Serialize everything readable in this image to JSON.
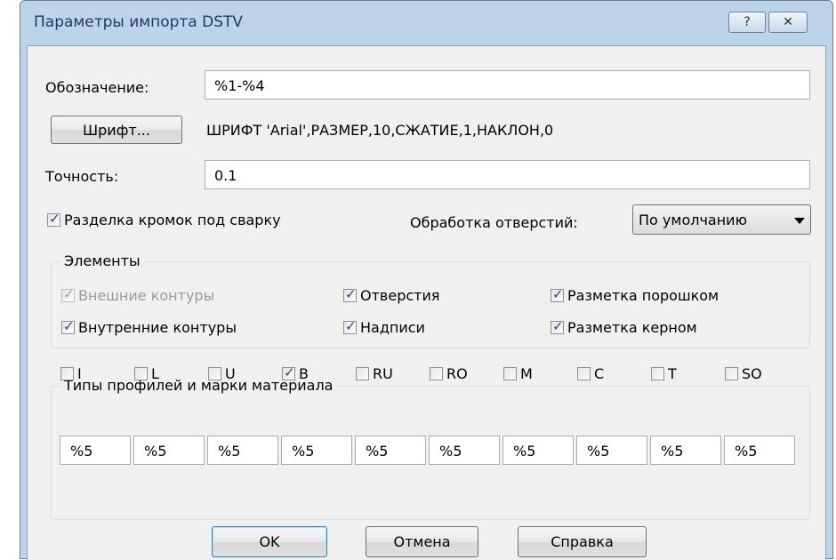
{
  "window": {
    "title": "Параметры импорта DSTV",
    "help_glyph": "?",
    "close_glyph": "✕"
  },
  "designation": {
    "label": "Обозначение:",
    "value": "%1-%4"
  },
  "font": {
    "button_label": "Шрифт...",
    "info": "ШРИФТ 'Arial',РАЗМЕР,10,СЖАТИЕ,1,НАКЛОН,0"
  },
  "precision": {
    "label": "Точность:",
    "value": "0.1"
  },
  "weld_prep": {
    "label": "Разделка кромок под сварку",
    "checked": true
  },
  "holes_processing": {
    "label": "Обработка отверстий:",
    "selected": "По умолчанию"
  },
  "elements": {
    "title": "Элементы",
    "outer_contours": {
      "label": "Внешние контуры",
      "checked": true,
      "disabled": true
    },
    "inner_contours": {
      "label": "Внутренние контуры",
      "checked": true
    },
    "holes": {
      "label": "Отверстия",
      "checked": true
    },
    "inscriptions": {
      "label": "Надписи",
      "checked": true
    },
    "powder_marking": {
      "label": "Разметка порошком",
      "checked": true
    },
    "punch_marking": {
      "label": "Разметка керном",
      "checked": true
    }
  },
  "profiles": {
    "title": "Типы профилей и марки материала",
    "items": [
      {
        "code": "I",
        "checked": false,
        "value": "%5"
      },
      {
        "code": "L",
        "checked": false,
        "value": "%5"
      },
      {
        "code": "U",
        "checked": false,
        "value": "%5"
      },
      {
        "code": "B",
        "checked": true,
        "value": "%5"
      },
      {
        "code": "RU",
        "checked": false,
        "value": "%5"
      },
      {
        "code": "RO",
        "checked": false,
        "value": "%5"
      },
      {
        "code": "M",
        "checked": false,
        "value": "%5"
      },
      {
        "code": "C",
        "checked": false,
        "value": "%5"
      },
      {
        "code": "T",
        "checked": false,
        "value": "%5"
      },
      {
        "code": "SO",
        "checked": false,
        "value": "%5"
      }
    ]
  },
  "buttons": {
    "ok": "OK",
    "cancel": "Отмена",
    "help": "Справка"
  }
}
